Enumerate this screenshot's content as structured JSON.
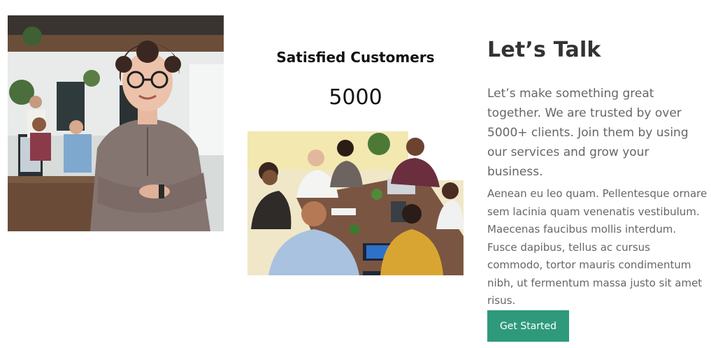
{
  "stats": {
    "title": "Satisfied Customers",
    "value": "5000"
  },
  "talk": {
    "heading": "Let’s Talk",
    "lead": "Let’s make something great together. We are trusted by over 5000+ clients. Join them by using our services and grow your business.",
    "body": "Aenean eu leo quam. Pellentesque ornare sem lacinia quam venenatis vestibulum. Maecenas faucibus mollis interdum. Fusce dapibus, tellus ac cursus commodo, tortor mauris condimentum nibh, ut fermentum massa justo sit amet risus.",
    "button_label": "Get Started"
  },
  "colors": {
    "accent": "#2e9a7b",
    "heading": "#333333",
    "body_text": "#666666"
  }
}
